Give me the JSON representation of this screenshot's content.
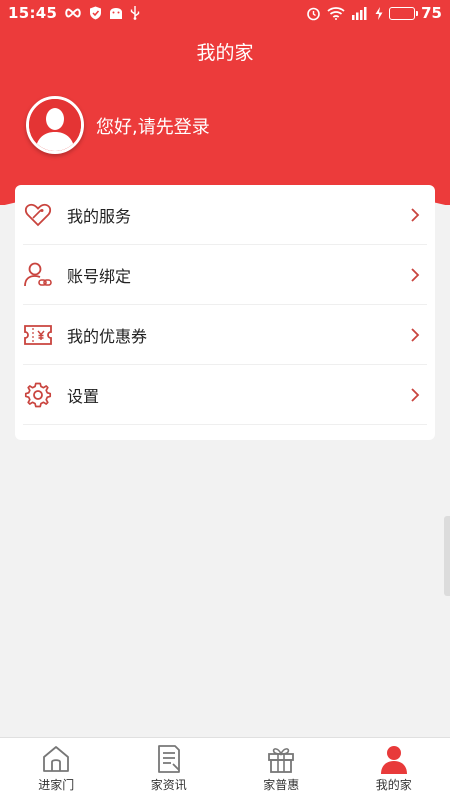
{
  "status_bar": {
    "time": "15:45",
    "battery": "75",
    "battery_level": 0.75
  },
  "header": {
    "title": "我的家",
    "login_prompt": "您好,请先登录"
  },
  "menu": {
    "items": [
      {
        "label": "我的服务",
        "icon": "heart-tag-icon"
      },
      {
        "label": "账号绑定",
        "icon": "user-link-icon"
      },
      {
        "label": "我的优惠券",
        "icon": "coupon-icon"
      },
      {
        "label": "设置",
        "icon": "gear-icon"
      }
    ]
  },
  "bottom_nav": {
    "tabs": [
      {
        "label": "进家门",
        "icon": "house-icon"
      },
      {
        "label": "家资讯",
        "icon": "news-icon"
      },
      {
        "label": "家普惠",
        "icon": "gift-icon"
      },
      {
        "label": "我的家",
        "icon": "person-icon",
        "active": true
      }
    ]
  },
  "colors": {
    "primary": "#ec3b3b",
    "icon_red": "#c9443e",
    "background": "#f2f2f2"
  }
}
